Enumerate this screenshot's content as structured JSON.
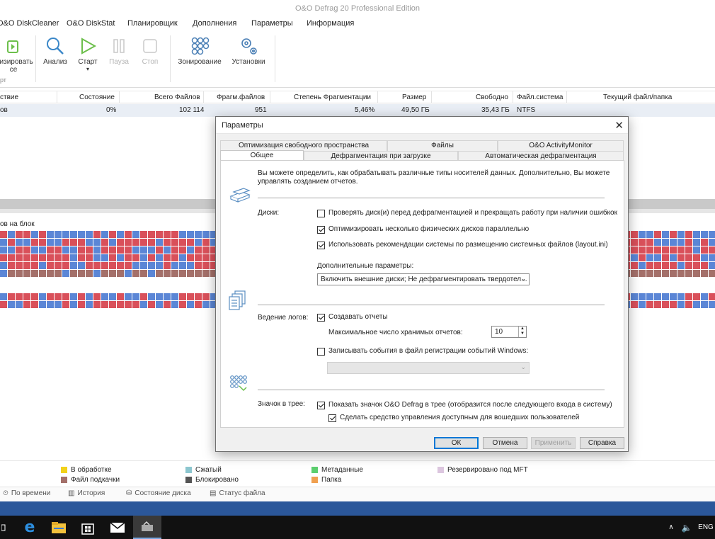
{
  "window": {
    "title": "O&O Defrag 20 Professional Edition"
  },
  "menu": [
    "O&O DiskCleaner",
    "O&O DiskStat",
    "Планировщик",
    "Дополнения",
    "Параметры",
    "Информация"
  ],
  "ribbon": {
    "clipped_label_1": "низировать",
    "clipped_label_2": "ce",
    "clipped_label_3": "рт",
    "analyze": "Анализ",
    "start": "Старт",
    "pause": "Пауза",
    "stop": "Стоп",
    "zoning": "Зонирование",
    "settings": "Установки"
  },
  "table": {
    "headers": [
      "ствие",
      "Состояние",
      "Всего Файлов",
      "Фрагм.файлов",
      "Степень Фрагментации",
      "Размер",
      "Свободно",
      "Файл.система",
      "Текущий файл/папка"
    ],
    "row": [
      "ов",
      "0%",
      "102 114",
      "951",
      "5,46%",
      "49,50 ГБ",
      "35,43 ГБ",
      "NTFS",
      ""
    ]
  },
  "clustermap": {
    "title": "ов на блок"
  },
  "legend": [
    {
      "label": "В обработке",
      "color": "#f2d21b"
    },
    {
      "label": "Сжатый",
      "color": "#8cc6cf"
    },
    {
      "label": "Метаданные",
      "color": "#5ccf6f"
    },
    {
      "label": "Резервировано под MFT",
      "color": "#dcc6df"
    },
    {
      "label": "Файл подкачки",
      "color": "#a4706a"
    },
    {
      "label": "Блокировано",
      "color": "#555555"
    },
    {
      "label": "Папка",
      "color": "#f0a050"
    }
  ],
  "status_tabs": [
    "По времени",
    "История",
    "Состояние диска",
    "Статус файла"
  ],
  "taskbar": {
    "lang": "ENG"
  },
  "dialog": {
    "title": "Параметры",
    "tabs_row1": [
      "Оптимизация свободного пространства",
      "Файлы",
      "O&O ActivityMonitor"
    ],
    "tabs_row2": [
      "Общее",
      "Дефрагментация при загрузке",
      "Автоматическая дефрагментация"
    ],
    "intro_line1": "Вы можете определить, как обрабатывать различные типы носителей данных. Дополнительно, Вы можете",
    "intro_line2": "управлять созданием отчетов.",
    "disks_label": "Диски:",
    "cb_check_before": "Проверять диск(и) перед дефрагментацией и прекращать работу при наличии ошибкок",
    "cb_parallel": "Оптимизировать несколько физических дисков параллельно",
    "cb_layout": "Использовать рекомендации системы по размещению системных файлов (layout.ini)",
    "extra_label": "Дополнительные параметры:",
    "extra_value": "Включить внешние диски; Не дефрагментировать твердотел...",
    "logs_label": "Ведение логов:",
    "cb_reports": "Создавать отчеты",
    "max_reports_label": "Максимальное число хранимых отчетов:",
    "max_reports_value": "10",
    "cb_eventlog": "Записывать события в файл регистрации событий Windows:",
    "tray_label": "Значок в трее:",
    "cb_tray": "Показать значок O&O Defrag в трее (отобразится после следующего входа в систему)",
    "cb_tray_all": "Сделать средство управления доступным для вошедших пользователей",
    "btn_ok": "ОК",
    "btn_cancel": "Отмена",
    "btn_apply": "Применить",
    "btn_help": "Справка"
  }
}
